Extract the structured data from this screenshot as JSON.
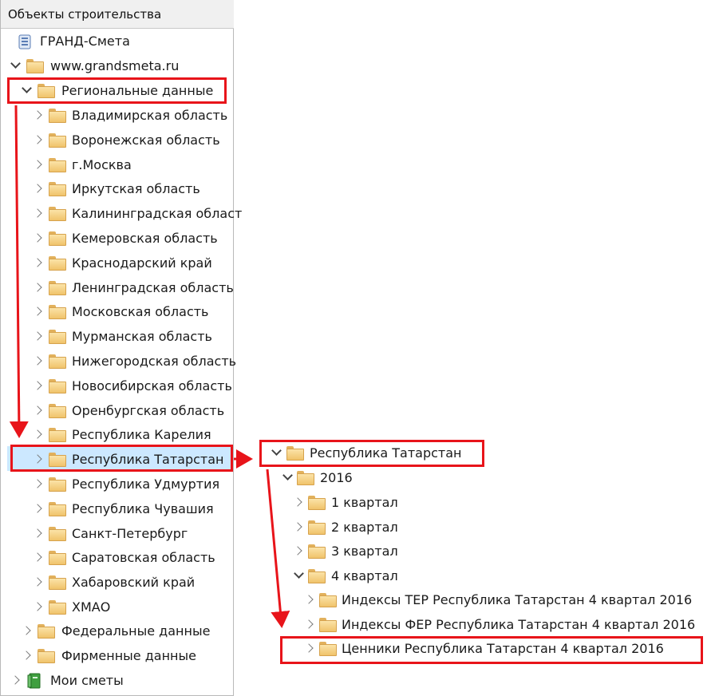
{
  "panel": {
    "header": "Объекты строительства"
  },
  "tree": {
    "grand_smeta": "ГРАНД-Смета",
    "site": "www.grandsmeta.ru",
    "regional": "Региональные данные",
    "regions": [
      "Владимирская область",
      "Воронежская область",
      "г.Москва",
      "Иркутская область",
      "Калининградская област",
      "Кемеровская область",
      "Краснодарский край",
      "Ленинградская область",
      "Московская область",
      "Мурманская область",
      "Нижегородская область",
      "Новосибирская область",
      "Оренбургская область",
      "Республика Карелия",
      "Республика Татарстан",
      "Республика Удмуртия",
      "Республика Чувашия",
      "Санкт-Петербург",
      "Саратовская область",
      "Хабаровский край",
      "ХМАО"
    ],
    "federal": "Федеральные данные",
    "company": "Фирменные данные",
    "my_estimates": "Мои сметы"
  },
  "expanded": {
    "root": "Республика Татарстан",
    "year": "2016",
    "quarters": [
      "1 квартал",
      "2 квартал",
      "3 квартал",
      "4 квартал"
    ],
    "q4_items": [
      "Индексы ТЕР Республика Татарстан 4 квартал 2016",
      "Индексы ФЕР Республика Татарстан 4 квартал 2016",
      "Ценники Республика Татарстан 4 квартал 2016"
    ]
  },
  "colors": {
    "highlight": "#e8141a",
    "selection": "#cce8ff",
    "folder": "#f0c36b"
  }
}
